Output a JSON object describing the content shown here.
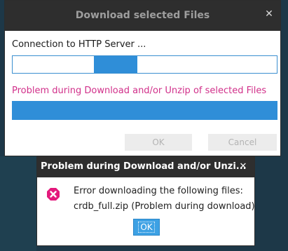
{
  "main_dialog": {
    "title": "Download selected Files",
    "close_glyph": "✕",
    "connection_text": "Connection to HTTP Server ...",
    "problem_text": "Problem during Download and/or Unzip of selected Files",
    "ok_label": "OK",
    "cancel_label": "Cancel",
    "download_progress": 1.0
  },
  "error_dialog": {
    "title": "Problem during Download and/or Unzi...",
    "close_glyph": "✕",
    "icon": "error-icon",
    "message_line1": "Error downloading the following files:",
    "message_line2": "crdb_full.zip (Problem during download)",
    "ok_label": "OK"
  },
  "colors": {
    "titlebar": "#2e2e2e",
    "progress_fill": "#2f8ed8",
    "problem_text": "#d1308a",
    "error_icon": "#e3197c",
    "ok_button": "#3da1e4"
  }
}
